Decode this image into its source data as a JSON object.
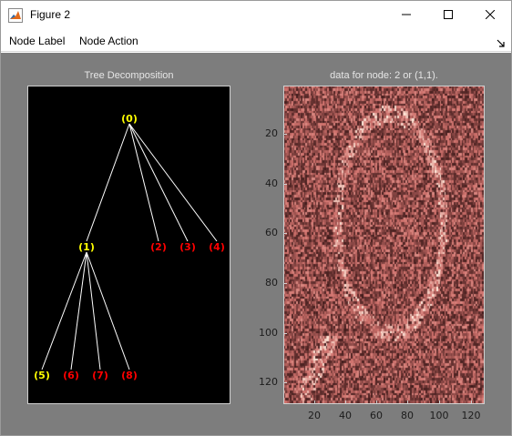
{
  "window": {
    "title": "Figure 2",
    "icons": {
      "app": "matlab-icon",
      "minimize": "minimize-icon",
      "maximize": "maximize-icon",
      "close": "close-icon",
      "dock": "dock-arrow-icon"
    }
  },
  "menu": {
    "items": [
      {
        "label": "Node Label"
      },
      {
        "label": "Node Action"
      }
    ]
  },
  "tree": {
    "title": "Tree Decomposition",
    "nodes": [
      {
        "label": "(0)",
        "color": "#ffff00"
      },
      {
        "label": "(1)",
        "color": "#ffff00"
      },
      {
        "label": "(2)",
        "color": "#ff0000"
      },
      {
        "label": "(3)",
        "color": "#ff0000"
      },
      {
        "label": "(4)",
        "color": "#ff0000"
      },
      {
        "label": "(5)",
        "color": "#ffff00"
      },
      {
        "label": "(6)",
        "color": "#ff0000"
      },
      {
        "label": "(7)",
        "color": "#ff0000"
      },
      {
        "label": "(8)",
        "color": "#ff0000"
      }
    ],
    "edges": [
      [
        0,
        1
      ],
      [
        0,
        2
      ],
      [
        0,
        3
      ],
      [
        0,
        4
      ],
      [
        1,
        5
      ],
      [
        1,
        6
      ],
      [
        1,
        7
      ],
      [
        1,
        8
      ]
    ]
  },
  "image_panel": {
    "title": "data for node: 2 or (1,1).",
    "y_ticks": [
      "20",
      "40",
      "60",
      "80",
      "100",
      "120"
    ],
    "x_ticks": [
      "20",
      "40",
      "60",
      "80",
      "100",
      "120"
    ],
    "colormap": "pink"
  },
  "colors": {
    "figure_bg": "#7d7d7d",
    "axes_bg": "#000000",
    "edge_color": "#ffffff"
  }
}
